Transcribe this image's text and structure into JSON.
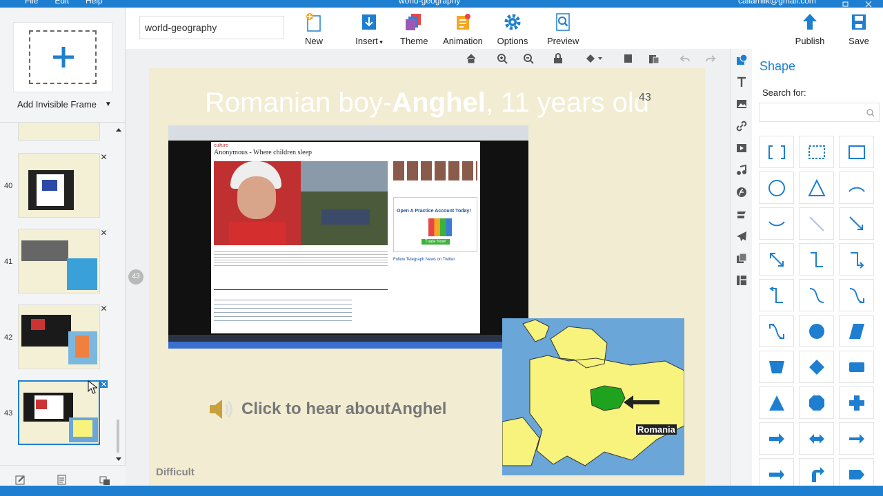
{
  "titlebar": {
    "menu": [
      "File",
      "Edit",
      "Help"
    ],
    "document": "world-geography",
    "user": "callamlik@gmail.com"
  },
  "toolbar": {
    "filename": "world-geography",
    "new": "New",
    "insert": "Insert",
    "theme": "Theme",
    "animation": "Animation",
    "options": "Options",
    "preview": "Preview",
    "publish": "Publish",
    "save": "Save"
  },
  "left": {
    "add_invisible_frame": "Add Invisible Frame",
    "frames": [
      {
        "num": "40"
      },
      {
        "num": "41"
      },
      {
        "num": "42"
      },
      {
        "num": "43"
      }
    ]
  },
  "slide": {
    "title_part1": "Romanian boy-",
    "title_bold": "Anghel",
    "title_part2": ", 11 years old",
    "frame_number": "43",
    "audio_text": "Click to hear aboutAnghel",
    "difficulty": "Difficult",
    "map_label": "Romania",
    "badge": "43",
    "screenshot": {
      "site_section": "culture",
      "headline": "Anonymous - Where children sleep",
      "ad_title": "Open A Practice Account Today!",
      "ad_button": "Trade Now!",
      "follow_text": "Follow Telegraph News on Twitter"
    }
  },
  "panel": {
    "title": "Shape",
    "search_label": "Search for:"
  },
  "colors": {
    "accent": "#1e7fd0",
    "slide_bg": "#f1ecd2",
    "map_water": "#6aa6d8",
    "map_land": "#f7f37c",
    "romania": "#1fa31f"
  }
}
